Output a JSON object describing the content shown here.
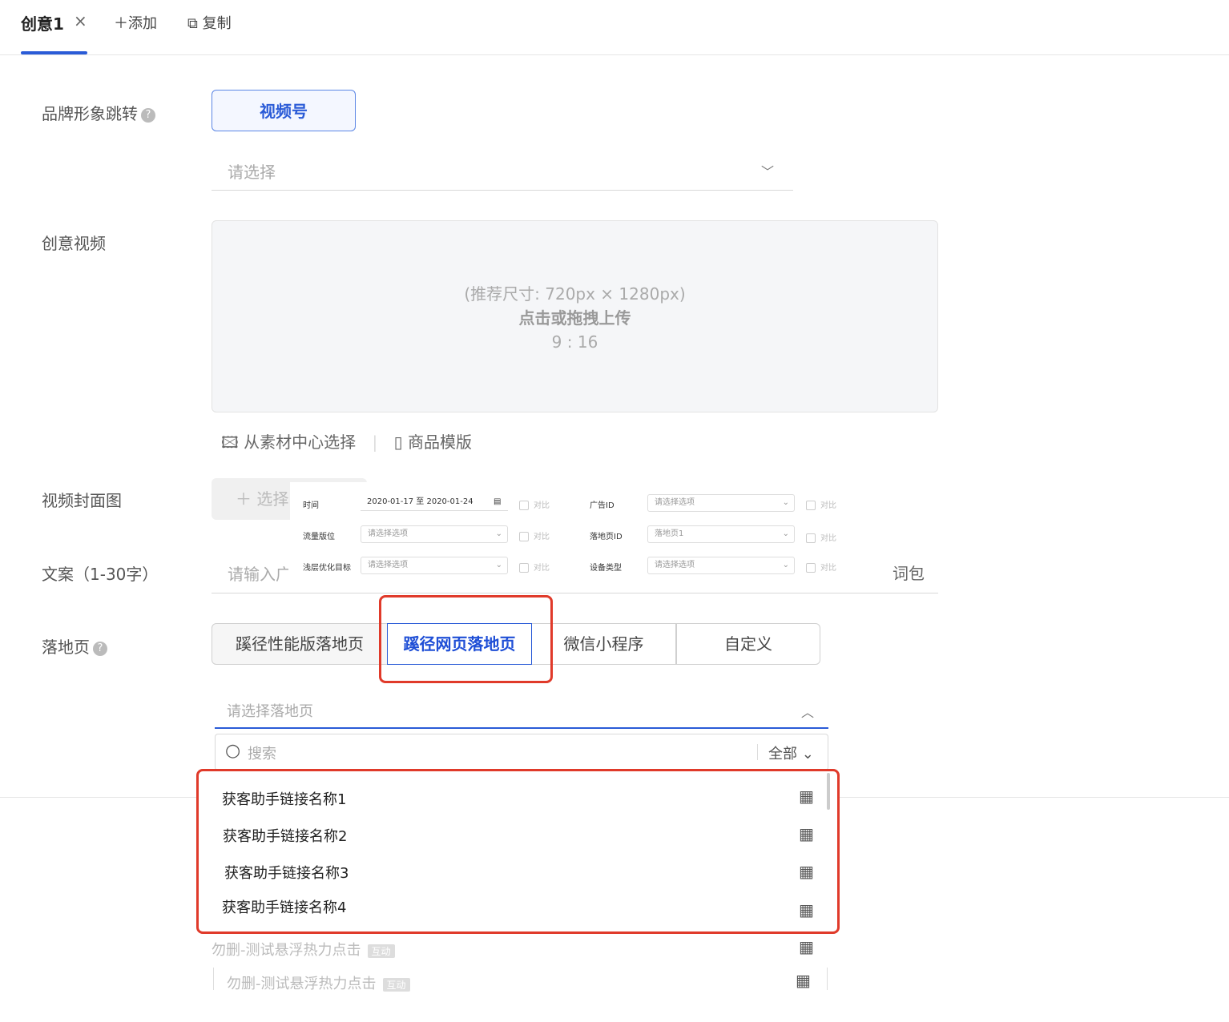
{
  "tabs": {
    "active": "创意1",
    "close": "×",
    "add": "＋添加",
    "copy": "复制"
  },
  "brand": {
    "label": "品牌形象跳转",
    "button": "视频号",
    "placeholder": "请选择"
  },
  "video": {
    "label": "创意视频",
    "hint": "(推荐尺寸: 720px × 1280px)",
    "action": "点击或拖拽上传",
    "ratio": "9 : 16",
    "link_library": "从素材中心选择",
    "link_template": "商品模版"
  },
  "cover": {
    "label": "视频封面图",
    "button": "＋ 选择"
  },
  "copytext": {
    "label": "文案（1-30字）",
    "placeholder": "请输入广",
    "wordpack": "词包"
  },
  "filters": {
    "time_label": "时间",
    "time_value": "2020-01-17 至 2020-01-24",
    "traffic_label": "流量版位",
    "traffic_value": "请选择选项",
    "goal_label": "浅层优化目标",
    "goal_value": "请选择选项",
    "ad_label": "广告ID",
    "ad_value": "请选择选项",
    "landing_label": "落地页ID",
    "landing_value": "落地页1",
    "device_label": "设备类型",
    "device_value": "请选择选项",
    "compare": "对比"
  },
  "landing": {
    "label": "落地页",
    "segments": [
      "蹊径性能版落地页",
      "蹊径网页落地页",
      "微信小程序",
      "自定义"
    ],
    "select_placeholder": "请选择落地页",
    "search_placeholder": "搜索",
    "filter_all": "全部",
    "items": [
      "获客助手链接名称1",
      "获客助手链接名称2",
      "获客助手链接名称3",
      "获客助手链接名称4"
    ],
    "faded_items": [
      "勿删-测试悬浮热力点击",
      "勿删-测试悬浮热力点击"
    ],
    "faded_tag": "互动"
  },
  "icons": {
    "qr": "qr-code-icon",
    "search": "search-icon",
    "help": "help-icon"
  },
  "colors": {
    "accent": "#2a5bd7",
    "highlight": "#e03a2a"
  }
}
